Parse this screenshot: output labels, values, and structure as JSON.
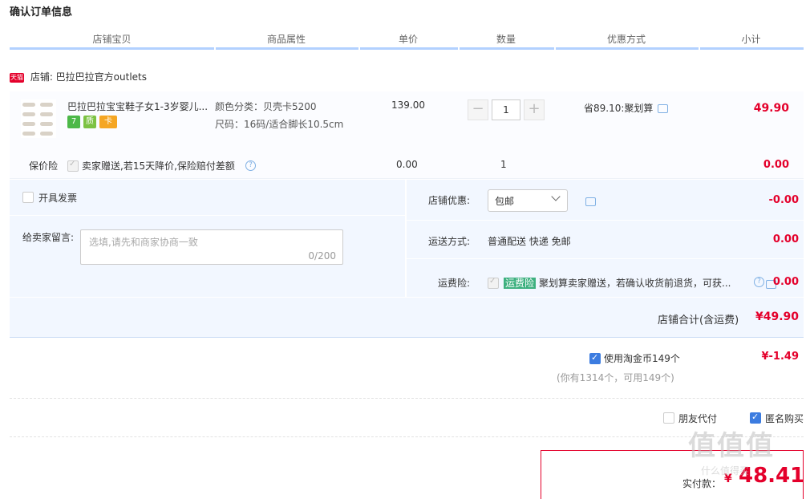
{
  "page_title": "确认订单信息",
  "columns": [
    "店铺宝贝",
    "商品属性",
    "单价",
    "数量",
    "优惠方式",
    "小计"
  ],
  "shop": {
    "badge": "天猫",
    "label": "店铺: 巴拉巴拉官方outlets"
  },
  "item": {
    "name": "巴拉巴拉宝宝鞋子女1-3岁婴儿...",
    "badges": [
      "7",
      "质",
      "卡"
    ],
    "attr_color": "颜色分类：贝壳卡5200",
    "attr_size": "尺码：16码/适合脚长10.5cm",
    "unit_price": "139.00",
    "quantity": "1",
    "qty_minus": "−",
    "qty_plus": "+",
    "promo": "省89.10:聚划算",
    "subtotal": "49.90"
  },
  "insurance": {
    "label": "保价险",
    "text": "卖家赠送,若15天降价,保险赔付差额",
    "help": "?",
    "price": "0.00",
    "qty": "1",
    "subtotal": "0.00"
  },
  "invoice_label": "开具发票",
  "message": {
    "label": "给卖家留言:",
    "placeholder": "选填,请先和商家协商一致",
    "count": "0/200"
  },
  "shop_discount": {
    "label": "店铺优惠:",
    "value": "包邮",
    "amount": "-0.00"
  },
  "shipping": {
    "label": "运送方式:",
    "value": "普通配送 快递 免邮",
    "amount": "0.00"
  },
  "freight_insurance": {
    "label": "运费险:",
    "tag": "运费险",
    "text": "聚划算卖家赠送，若确认收货前退货，可获...",
    "help": "?",
    "amount": "0.00"
  },
  "shop_total": {
    "label": "店铺合计(含运费)",
    "value": "¥49.90"
  },
  "coins": {
    "label": "使用淘金币149个",
    "note": "(你有1314个，可用149个)",
    "amount": "¥-1.49",
    "checked": true
  },
  "friend_pay": {
    "label": "朋友代付",
    "checked": false
  },
  "anonymous": {
    "label": "匿名购买",
    "checked": true
  },
  "payment": {
    "label": "实付款：",
    "currency": "¥",
    "value": "48.41"
  },
  "watermark": {
    "main": "值值值",
    "sub": "什么值得买"
  },
  "colors": {
    "accent": "#e4002b",
    "blue": "#3c7ce0",
    "panel": "#f2f7ff"
  }
}
